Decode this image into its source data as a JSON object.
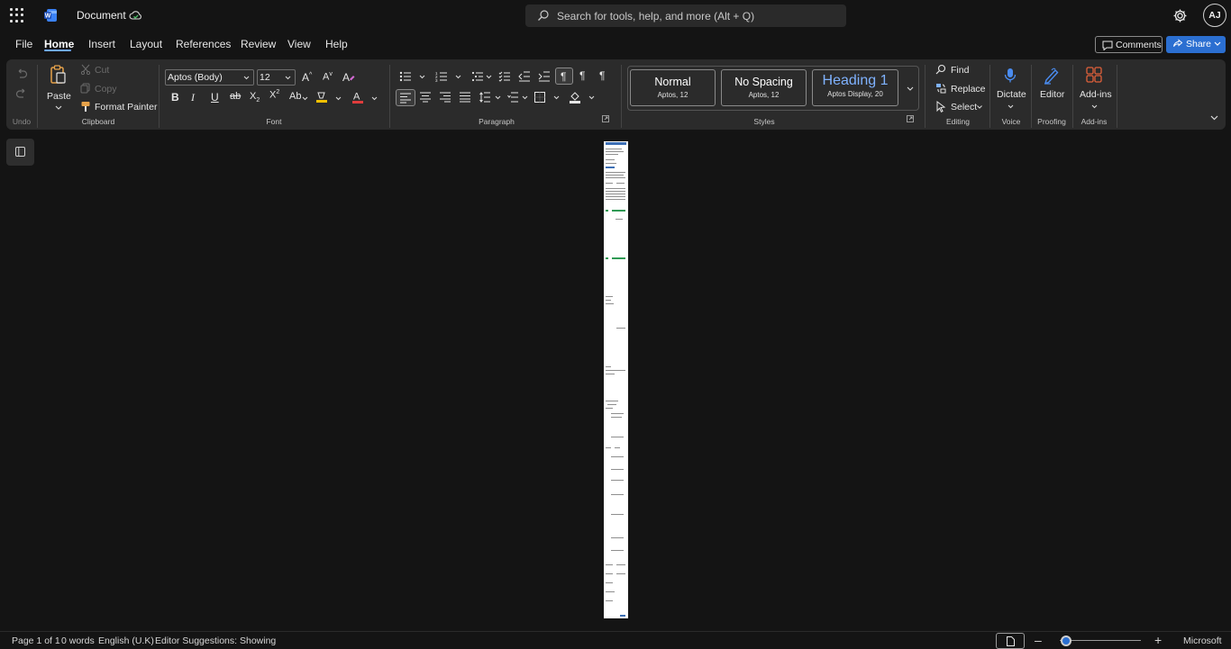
{
  "title_bar": {
    "document_title": "Document",
    "search_placeholder": "Search for tools, help, and more (Alt + Q)",
    "avatar_initials": "AJ"
  },
  "menu": {
    "tabs": [
      "File",
      "Home",
      "Insert",
      "Layout",
      "References",
      "Review",
      "View",
      "Help"
    ],
    "active_tab": "Home",
    "comments_label": "Comments",
    "share_label": "Share"
  },
  "ribbon": {
    "undo_group": {
      "label": "Undo"
    },
    "clipboard": {
      "paste": "Paste",
      "cut": "Cut",
      "copy": "Copy",
      "format_painter": "Format Painter",
      "label": "Clipboard"
    },
    "font": {
      "font_name": "Aptos (Body)",
      "font_size": "12",
      "label": "Font"
    },
    "paragraph": {
      "label": "Paragraph"
    },
    "styles": {
      "items": [
        {
          "name": "Normal",
          "sub": "Aptos, 12"
        },
        {
          "name": "No Spacing",
          "sub": "Aptos, 12"
        },
        {
          "name": "Heading 1",
          "sub": "Aptos Display, 20"
        }
      ],
      "label": "Styles"
    },
    "editing": {
      "find": "Find",
      "replace": "Replace",
      "select": "Select",
      "label": "Editing"
    },
    "voice": {
      "dictate": "Dictate",
      "label": "Voice"
    },
    "proofing": {
      "editor": "Editor",
      "label": "Proofing"
    },
    "addins": {
      "addins": "Add-ins",
      "label": "Add-ins"
    }
  },
  "status_bar": {
    "page": "Page 1 of 1",
    "words": "0 words",
    "language": "English (U.K)",
    "editor": "Editor Suggestions: Showing",
    "brand": "Microsoft"
  },
  "colors": {
    "accent": "#2b6fd1",
    "background": "#141414",
    "ribbon": "#2b2b2b",
    "font_color_red": "#e03c3c",
    "highlight_yellow": "#f2c000"
  }
}
